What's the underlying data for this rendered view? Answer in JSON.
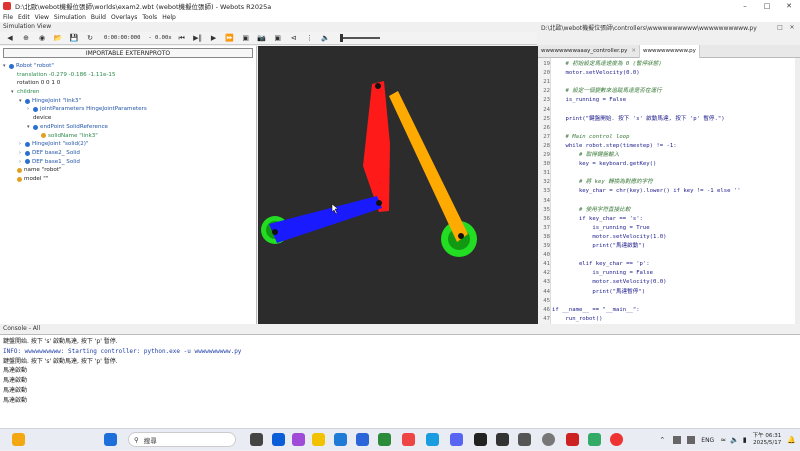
{
  "window": {
    "title": "D:\\北歐\\webot機擬位張師\\worlds\\exam2.wbt (webot機擬位張師) - Webots R2025a"
  },
  "menu": [
    "File",
    "Edit",
    "View",
    "Simulation",
    "Build",
    "Overlays",
    "Tools",
    "Help"
  ],
  "sim_view_label": "Simulation View",
  "toolbar": {
    "time": "0:00:00:000",
    "speed": "- 0.00x"
  },
  "scene_tree": {
    "extern_button": "IMPORTABLE EXTERNPROTO",
    "nodes": [
      {
        "label": "Robot \"robot\"",
        "indent": 0,
        "arrow": "▾",
        "dot": "#2a6fd1",
        "style": "blue"
      },
      {
        "label": "translation -0.279 -0.186 -1.11e-15",
        "indent": 1,
        "arrow": "",
        "dot": "",
        "style": "green"
      },
      {
        "label": "rotation 0 0 1 0",
        "indent": 1,
        "arrow": "",
        "dot": "",
        "style": "dark"
      },
      {
        "label": "children",
        "indent": 1,
        "arrow": "▾",
        "dot": "",
        "style": "green"
      },
      {
        "label": "HingeJoint \"link3\"",
        "indent": 2,
        "arrow": "▾",
        "dot": "#2a6fd1",
        "style": "blue"
      },
      {
        "label": "jointParameters HingeJointParameters",
        "indent": 3,
        "arrow": "›",
        "dot": "#2a6fd1",
        "style": "blue"
      },
      {
        "label": "device",
        "indent": 3,
        "arrow": "",
        "dot": "",
        "style": "dark"
      },
      {
        "label": "endPoint SolidReference",
        "indent": 3,
        "arrow": "▾",
        "dot": "#2a6fd1",
        "style": "blue"
      },
      {
        "label": "solidName \"link3\"",
        "indent": 4,
        "arrow": "",
        "dot": "#e0a020",
        "style": "green"
      },
      {
        "label": "HingeJoint \"solid(2)\"",
        "indent": 2,
        "arrow": "›",
        "dot": "#2a6fd1",
        "style": "blue"
      },
      {
        "label": "DEF base2_ Solid",
        "indent": 2,
        "arrow": "›",
        "dot": "#2a6fd1",
        "style": "blue"
      },
      {
        "label": "DEF base1_ Solid",
        "indent": 2,
        "arrow": "›",
        "dot": "#2a6fd1",
        "style": "blue"
      },
      {
        "label": "name \"robot\"",
        "indent": 1,
        "arrow": "",
        "dot": "#e0a020",
        "style": "dark"
      },
      {
        "label": "model \"\"",
        "indent": 1,
        "arrow": "",
        "dot": "#e0a020",
        "style": "dark"
      }
    ]
  },
  "editor": {
    "path": "D:\\北歐\\webot機擬位張師\\controllers\\wwwwwwwwww\\wwwwwwwwww.py",
    "tabs": [
      {
        "label": "wwwwwwwwaaay_controller.py",
        "active": false
      },
      {
        "label": "wwwwwwwwww.py",
        "active": true
      }
    ],
    "lines": [
      {
        "n": "19",
        "t": "    # 初始設定馬達速度為 0 (暫停狀態)",
        "c": "cm"
      },
      {
        "n": "20",
        "t": "    motor.setVelocity(0.0)",
        "c": ""
      },
      {
        "n": "21",
        "t": "",
        "c": ""
      },
      {
        "n": "22",
        "t": "    # 設定一個變數來追蹤馬達是否在運行",
        "c": "cm"
      },
      {
        "n": "23",
        "t": "    is_running = False",
        "c": ""
      },
      {
        "n": "24",
        "t": "",
        "c": ""
      },
      {
        "n": "25",
        "t": "    print(\"鍵盤開始. 按下 's' 啟動馬達, 按下 'p' 暫停.\")",
        "c": ""
      },
      {
        "n": "26",
        "t": "",
        "c": ""
      },
      {
        "n": "27",
        "t": "    # Main control loop",
        "c": "cm"
      },
      {
        "n": "28",
        "t": "    while robot.step(timestep) != -1:",
        "c": ""
      },
      {
        "n": "29",
        "t": "        # 取得鍵盤輸入",
        "c": "cm"
      },
      {
        "n": "30",
        "t": "        key = keyboard.getKey()",
        "c": ""
      },
      {
        "n": "31",
        "t": "",
        "c": ""
      },
      {
        "n": "32",
        "t": "        # 將 key 轉換為對應的字符",
        "c": "cm"
      },
      {
        "n": "33",
        "t": "        key_char = chr(key).lower() if key != -1 else ''",
        "c": ""
      },
      {
        "n": "34",
        "t": "",
        "c": ""
      },
      {
        "n": "35",
        "t": "        # 使用字符直接比較",
        "c": "cm"
      },
      {
        "n": "36",
        "t": "        if key_char == 's':",
        "c": ""
      },
      {
        "n": "37",
        "t": "            is_running = True",
        "c": ""
      },
      {
        "n": "38",
        "t": "            motor.setVelocity(1.0)",
        "c": ""
      },
      {
        "n": "39",
        "t": "            print(\"馬達啟動\")",
        "c": ""
      },
      {
        "n": "40",
        "t": "",
        "c": ""
      },
      {
        "n": "41",
        "t": "        elif key_char == 'p':",
        "c": ""
      },
      {
        "n": "42",
        "t": "            is_running = False",
        "c": ""
      },
      {
        "n": "43",
        "t": "            motor.setVelocity(0.0)",
        "c": ""
      },
      {
        "n": "44",
        "t": "            print(\"馬達暫停\")",
        "c": ""
      },
      {
        "n": "45",
        "t": "",
        "c": ""
      },
      {
        "n": "46",
        "t": "if __name__ == \"__main__\":",
        "c": ""
      },
      {
        "n": "47",
        "t": "    run_robot()",
        "c": ""
      }
    ]
  },
  "console": {
    "label": "Console - All",
    "lines": [
      {
        "t": "鍵盤開始. 按下 's' 啟動馬達, 按下 'p' 暫停.",
        "k": ""
      },
      {
        "t": "INFO: wwwwwwwwww: Starting controller: python.exe -u wwwwwwwwww.py",
        "k": "info"
      },
      {
        "t": "鍵盤開始. 按下 's' 啟動馬達, 按下 'p' 暫停.",
        "k": ""
      },
      {
        "t": "馬達啟動",
        "k": ""
      },
      {
        "t": "馬達啟動",
        "k": ""
      },
      {
        "t": "馬達啟動",
        "k": ""
      },
      {
        "t": "馬達啟動",
        "k": ""
      }
    ]
  },
  "taskbar": {
    "search_placeholder": "搜尋",
    "lang": "ENG",
    "time": "下午 06:31",
    "date": "2025/5/17"
  },
  "colors": {
    "link_red": "#ff1a1a",
    "link_blue": "#1a1aff",
    "link_orange": "#ffaa00",
    "base_green": "#22dd22",
    "viewport_bg": "#2c2c2c"
  }
}
